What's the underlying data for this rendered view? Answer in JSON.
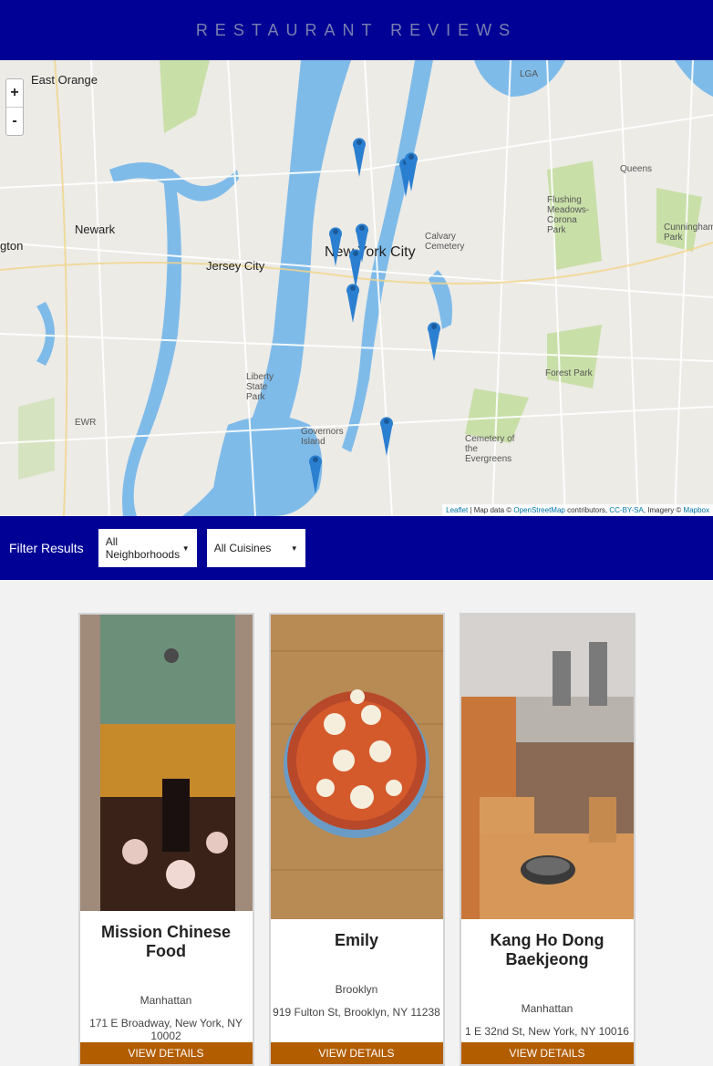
{
  "header": {
    "title": "Restaurant Reviews"
  },
  "map": {
    "zoom_in": "+",
    "zoom_out": "-",
    "labels": {
      "east_orange": "East Orange",
      "newark": "Newark",
      "jersey_city": "Jersey City",
      "new_york_city": "New York City",
      "queens": "Queens",
      "liberty_state_park": "Liberty State Park",
      "governors_island": "Governors Island",
      "flushing_meadows": "Flushing Meadows-Corona Park",
      "forest_park": "Forest Park",
      "cunningham_park": "Cunningham Park",
      "cemetery": "Cemetery of the Evergreens",
      "calvary": "Calvary Cemetery",
      "ewr": "EWR",
      "lga": "LGA",
      "edge": "gton"
    },
    "attribution": {
      "leaflet": "Leaflet",
      "text1": " | Map data © ",
      "osm": "OpenStreetMap",
      "text2": " contributors, ",
      "license": "CC-BY-SA",
      "text3": ", Imagery © ",
      "mapbox": "Mapbox"
    },
    "marker_color": "#2b7fd0"
  },
  "filter": {
    "label": "Filter Results",
    "neighborhood": "All Neighborhoods",
    "cuisine": "All Cuisines"
  },
  "restaurants": [
    {
      "name": "Mission Chinese Food",
      "neighborhood": "Manhattan",
      "address": "171 E Broadway, New York, NY 10002",
      "button": "View Details"
    },
    {
      "name": "Emily",
      "neighborhood": "Brooklyn",
      "address": "919 Fulton St, Brooklyn, NY 11238",
      "button": "View Details"
    },
    {
      "name": "Kang Ho Dong Baekjeong",
      "neighborhood": "Manhattan",
      "address": "1 E 32nd St, New York, NY 10016",
      "button": "View Details"
    }
  ],
  "colors": {
    "header": "#020195",
    "button": "#b25d00"
  }
}
